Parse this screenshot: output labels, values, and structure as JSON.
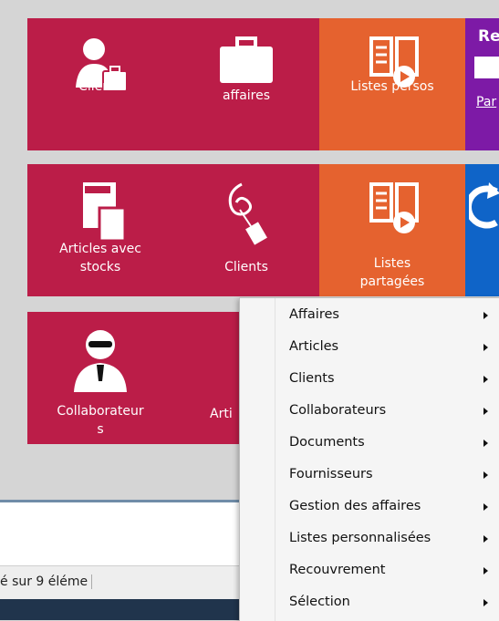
{
  "tiles": [
    {
      "label": "Clients",
      "color": "#bb1d48",
      "icon": "user-briefcase-icon"
    },
    {
      "label": "Codes\naffaires",
      "color": "#bb1d48",
      "icon": "briefcase-icon"
    },
    {
      "label": "Listes persos",
      "color": "#e5622f",
      "icon": "list-arrow-icon"
    },
    {
      "label": "Re",
      "sub": "Par",
      "color": "#7d1aa6",
      "icon": "search-icon"
    },
    {
      "label": "Articles avec\nstocks",
      "color": "#bb1d48",
      "icon": "documents-icon"
    },
    {
      "label": "Clients",
      "color": "#bb1d48",
      "icon": "tag-icon"
    },
    {
      "label": "Listes\npartagées",
      "color": "#e5622f",
      "icon": "list-arrow-icon"
    },
    {
      "label": "",
      "color": "#0f64c8",
      "icon": "refresh-icon"
    },
    {
      "label": "Collaborateur\ns",
      "color": "#bb1d48",
      "icon": "agent-icon"
    },
    {
      "label": "Arti",
      "color": "#bb1d48",
      "icon": "document-icon"
    }
  ],
  "status": {
    "text": "é sur 9 éléme"
  },
  "context_menu": {
    "items": [
      {
        "label": "Affaires"
      },
      {
        "label": "Articles"
      },
      {
        "label": "Clients"
      },
      {
        "label": "Collaborateurs"
      },
      {
        "label": "Documents"
      },
      {
        "label": "Fournisseurs"
      },
      {
        "label": "Gestion des affaires"
      },
      {
        "label": "Listes personnalisées"
      },
      {
        "label": "Recouvrement"
      },
      {
        "label": "Sélection"
      }
    ]
  }
}
